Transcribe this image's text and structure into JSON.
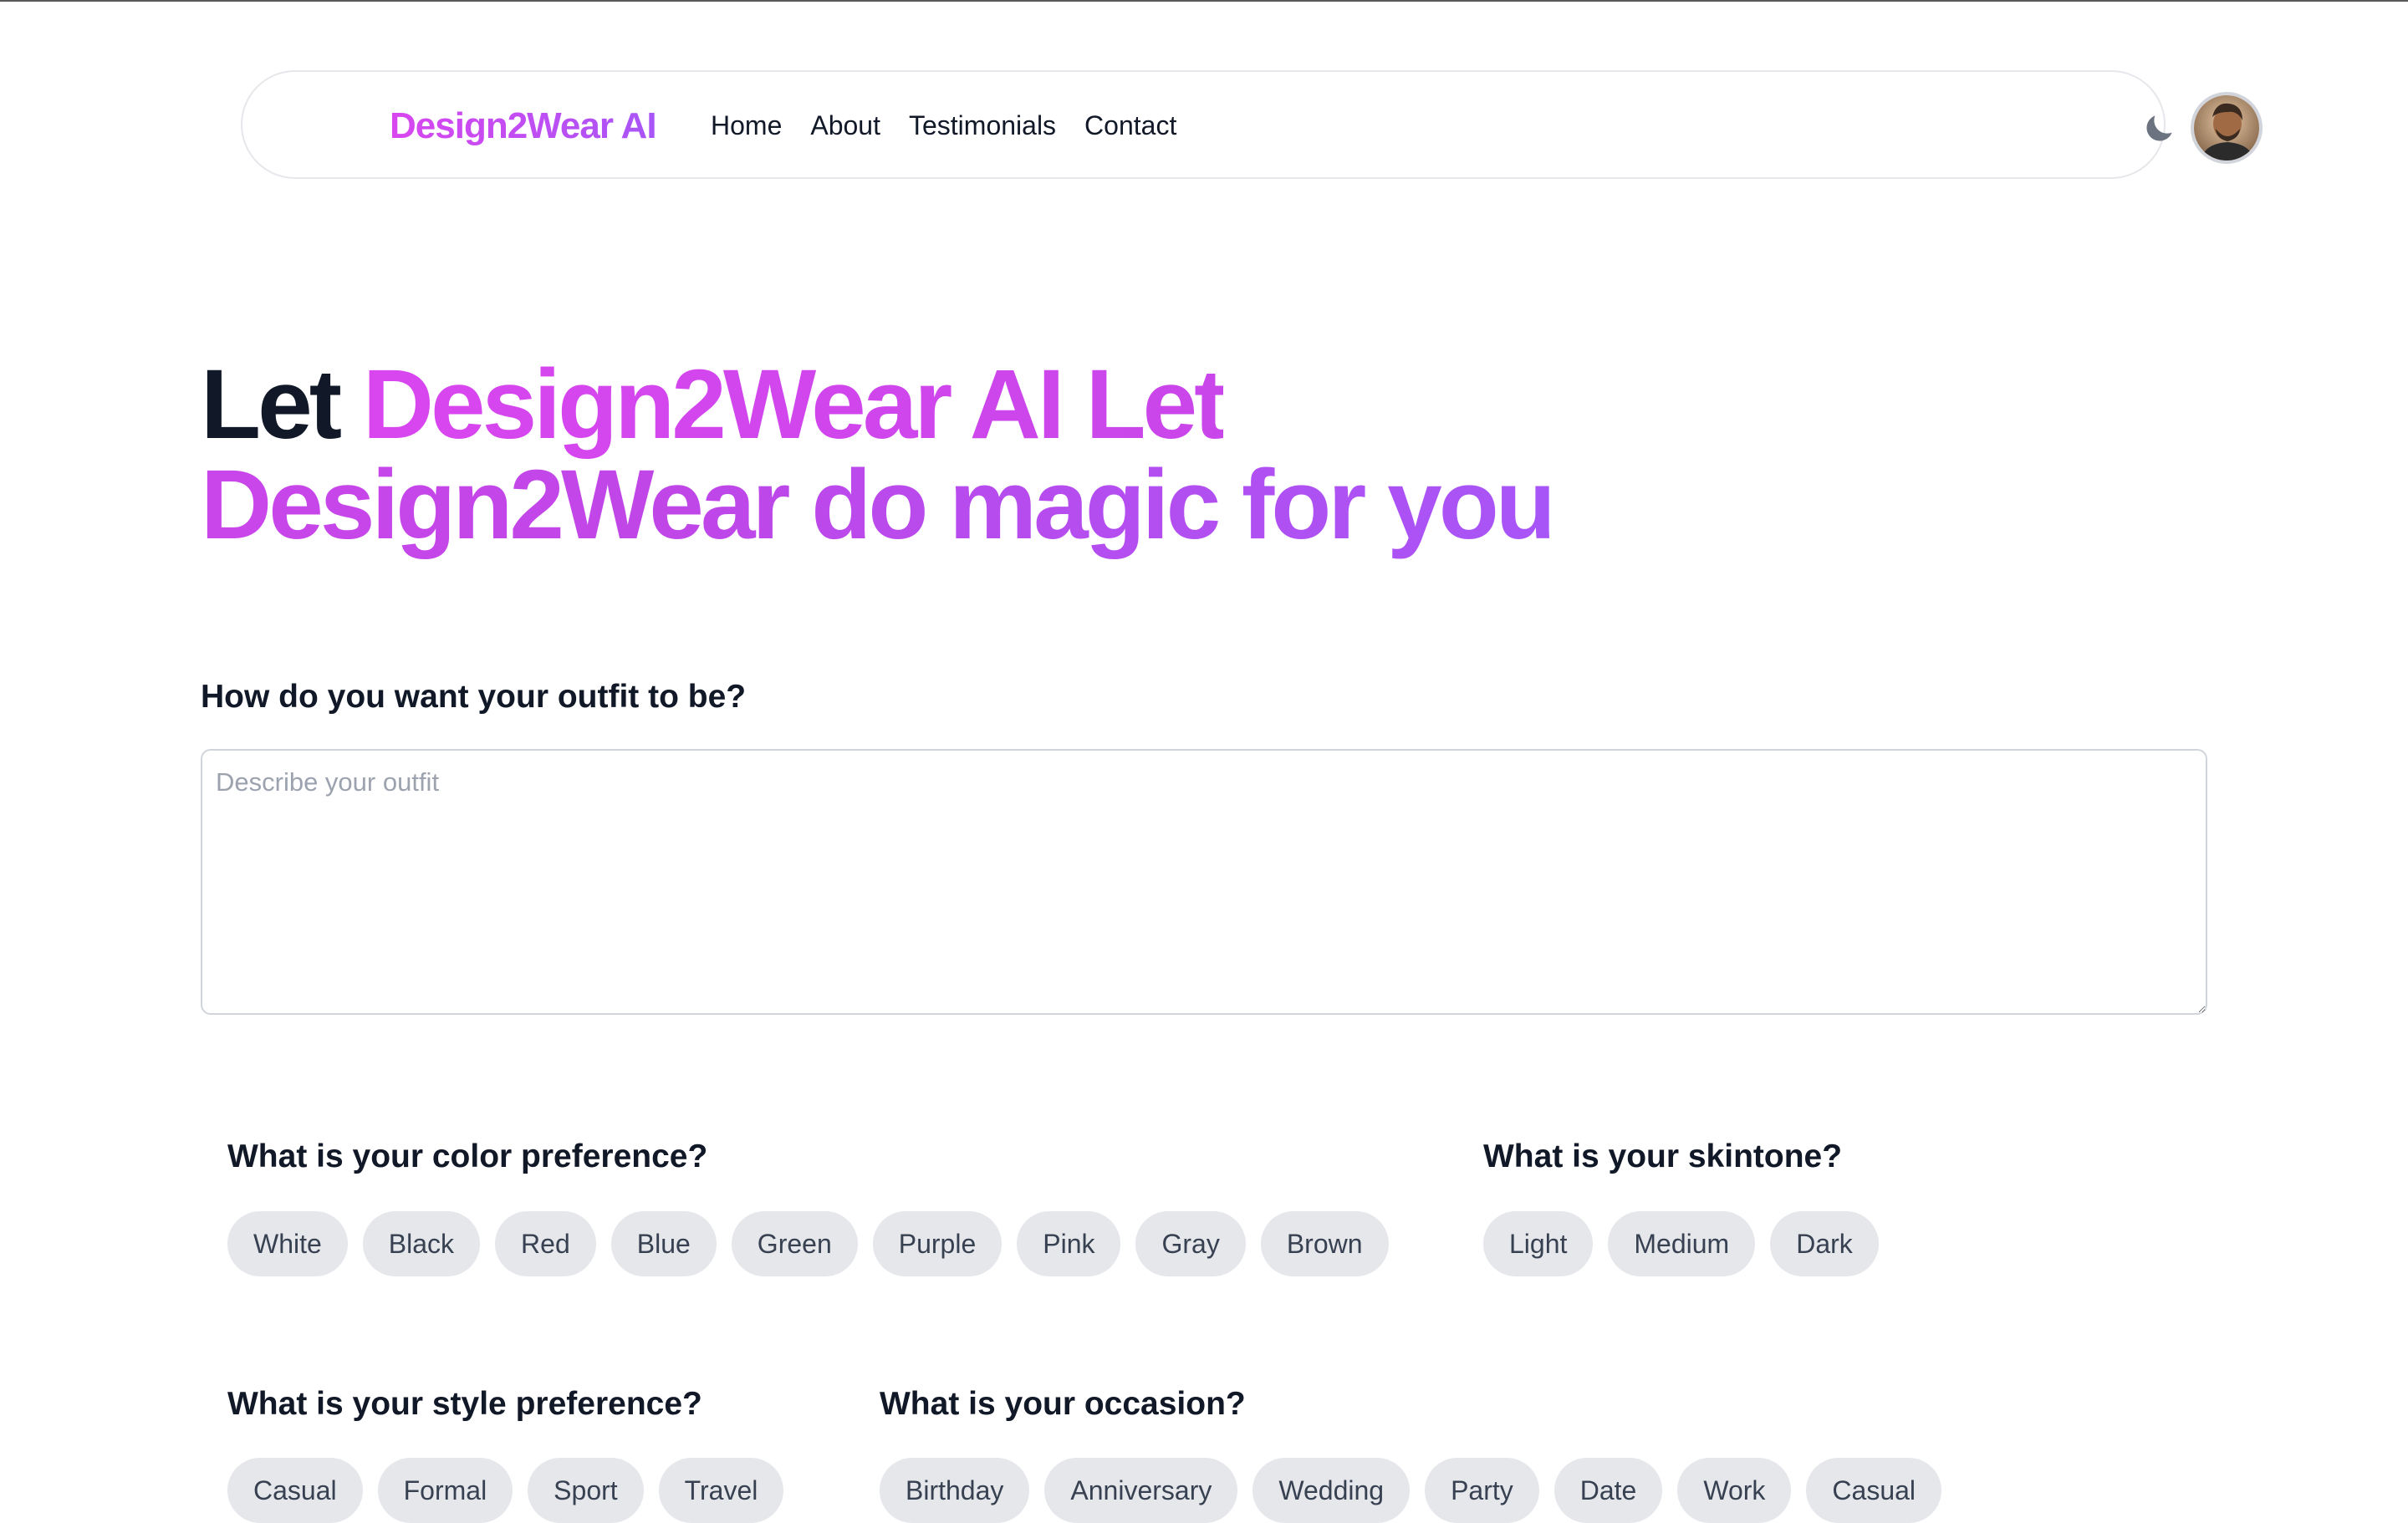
{
  "nav": {
    "brand": "Design2Wear AI",
    "links": [
      "Home",
      "About",
      "Testimonials",
      "Contact"
    ],
    "theme_toggle_icon": "moon-icon",
    "avatar_icon": "user-avatar"
  },
  "hero": {
    "word_plain": "Let ",
    "title_gradient": "Design2Wear AI Let Design2Wear do magic for you"
  },
  "outfit": {
    "label": "How do you want your outfit to be?",
    "placeholder": "Describe your outfit",
    "value": ""
  },
  "color_pref": {
    "label": "What is your color preference?",
    "options": [
      "White",
      "Black",
      "Red",
      "Blue",
      "Green",
      "Purple",
      "Pink",
      "Gray",
      "Brown"
    ]
  },
  "skintone": {
    "label": "What is your skintone?",
    "options": [
      "Light",
      "Medium",
      "Dark"
    ]
  },
  "style_pref": {
    "label": "What is your style preference?",
    "options": [
      "Casual",
      "Formal",
      "Sport",
      "Travel"
    ]
  },
  "occasion": {
    "label": "What is your occasion?",
    "options": [
      "Birthday",
      "Anniversary",
      "Wedding",
      "Party",
      "Date",
      "Work",
      "Casual"
    ]
  },
  "colors": {
    "accent_start": "#d946ef",
    "accent_end": "#a855f7",
    "chip_bg": "#e5e7eb",
    "text": "#111827"
  }
}
